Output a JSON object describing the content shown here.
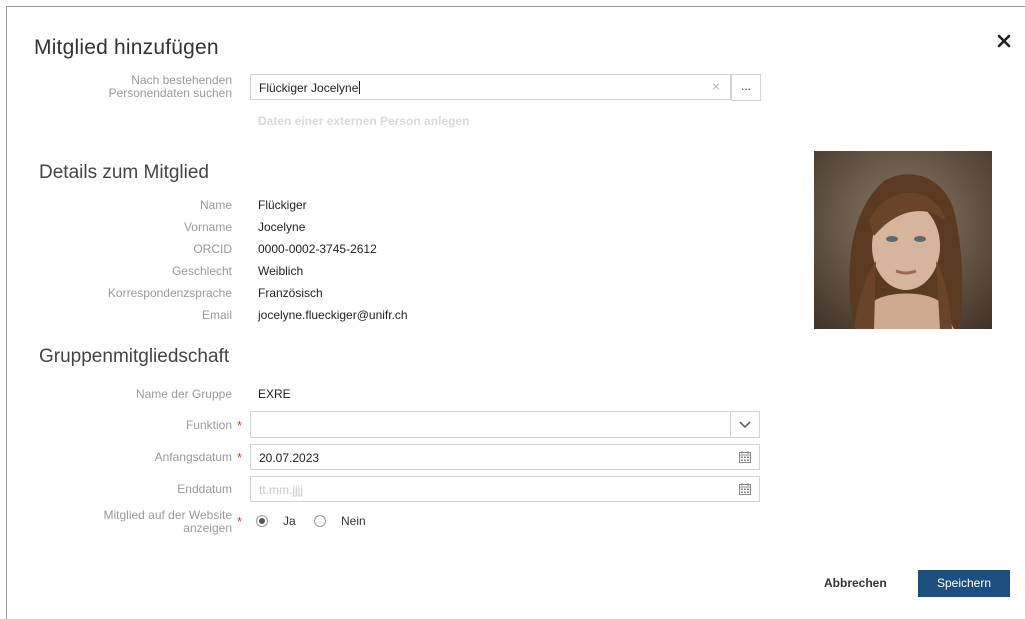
{
  "dialog": {
    "title": "Mitglied hinzufügen",
    "close_icon": "close-icon"
  },
  "search": {
    "label_line1": "Nach bestehenden",
    "label_line2": "Personendaten suchen",
    "value": "Flückiger Jocelyne",
    "clear_label": "×",
    "browse_label": "...",
    "external_link": "Daten einer externen Person anlegen"
  },
  "details": {
    "heading": "Details zum Mitglied",
    "fields": [
      {
        "label": "Name",
        "value": "Flückiger"
      },
      {
        "label": "Vorname",
        "value": "Jocelyne"
      },
      {
        "label": "ORCID",
        "value": "0000-0002-3745-2612"
      },
      {
        "label": "Geschlecht",
        "value": "Weiblich"
      },
      {
        "label": "Korrespondenzsprache",
        "value": "Französisch"
      },
      {
        "label": "Email",
        "value": "jocelyne.flueckiger@unifr.ch"
      }
    ]
  },
  "membership": {
    "heading": "Gruppenmitgliedschaft",
    "group_label": "Name der Gruppe",
    "group_value": "EXRE",
    "function_label": "Funktion",
    "function_value": "",
    "start_label": "Anfangsdatum",
    "start_value": "20.07.2023",
    "end_label": "Enddatum",
    "end_placeholder": "tt.mm.jjjj",
    "website_label_line1": "Mitglied auf der Website",
    "website_label_line2": "anzeigen",
    "option_yes": "Ja",
    "option_no": "Nein",
    "required_mark": "*"
  },
  "actions": {
    "cancel": "Abbrechen",
    "save": "Speichern"
  },
  "colors": {
    "primary_button": "#1d4f7e",
    "required": "#d9392b",
    "label": "#9a9a9a"
  }
}
